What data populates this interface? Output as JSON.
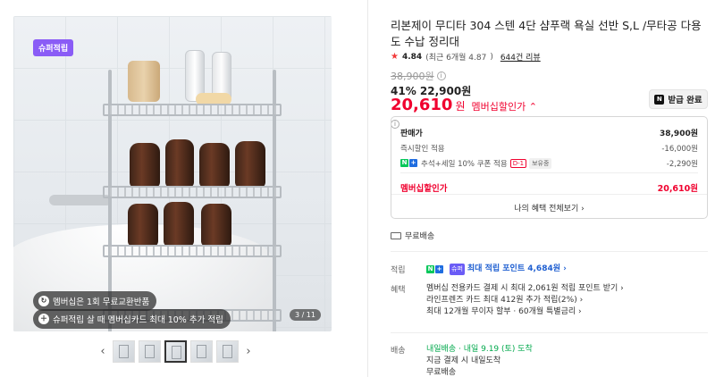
{
  "gallery": {
    "badge": "슈퍼적립",
    "pill_1": "멤버십은 1회 무료교환반품",
    "pill_2": "슈퍼적립 살 때 멤버십카드 최대 10% 추가 적립",
    "counter": "3 / 11",
    "prev_arrow": "‹",
    "next_arrow": "›"
  },
  "product": {
    "title": "리본제이 무디타 304 스텐 4단 샴푸랙 욕실 선반 S,L /무타공 다용도 수납 정리대",
    "rating": {
      "star": "★",
      "score": "4.84",
      "recent": "(최근 6개월 4.87",
      "recent_close": ")",
      "reviews": "644건 리뷰"
    },
    "original_price": "38,900원",
    "discount_pct": "41%",
    "sale_price": "22,900원",
    "member_price": "20,610",
    "member_won": "원",
    "member_label": "멤버십할인가 ⌃",
    "coupon_button": "받급 완료"
  },
  "price_box": {
    "rows": [
      {
        "label": "판매가",
        "value": "38,900원"
      },
      {
        "label": "즉시할인 적용",
        "value": "-16,000원"
      },
      {
        "label": "추석+세일 10% 쿠폰 적용",
        "d1": "D-1",
        "tag": "보유중",
        "value": "-2,290원"
      }
    ],
    "total_label": "멤버십할인가",
    "total_value": "20,610원",
    "all_benefits": "나의 혜택 전체보기 ›"
  },
  "shipping_free": "무료배송",
  "benefits": {
    "points_key": "적립",
    "points_value": "최대 적립 포인트 4,684원 ›",
    "super_tag": "슈퍼",
    "perk_key": "혜택",
    "perks": [
      "멤버십 전용카드 결제 시 최대 2,061원 적립 포인트 받기 ›",
      "라인프렌즈 카드 최대 412원 추가 적립(2%) ›",
      "최대 12개월 무이자 할부 · 60개월 특별금리 ›"
    ]
  },
  "delivery": {
    "key": "배송",
    "line_1": "내일배송 · 내일 9.19 (토) 도착",
    "line_2": "지금 결제 시 내일도착",
    "line_3": "무료배송"
  },
  "colors": {
    "accent_red": "#f0002e",
    "super_purple": "#8a5cf6",
    "naver_green": "#03c75a"
  }
}
